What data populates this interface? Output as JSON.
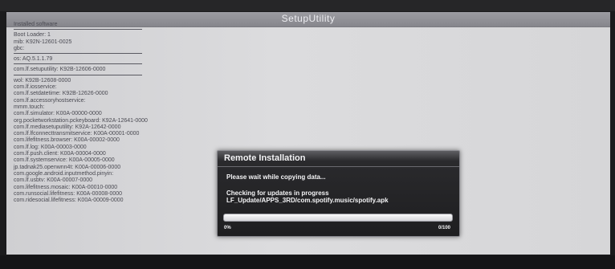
{
  "window": {
    "title": "SetupUtility"
  },
  "info_sections": [
    {
      "lines": [
        "Installed software"
      ]
    },
    {
      "lines": [
        "Boot Loader: 1",
        "mib: K92N-12601-0025",
        "gbc:"
      ]
    },
    {
      "lines": [
        "os: AQ.5.1.1.79"
      ]
    },
    {
      "lines": [
        "com.lf.setuputility: K92B-12606-0000"
      ]
    },
    {
      "lines": [
        "wol: K92B-12608-0000",
        "com.lf.iosservice:",
        "com.lf.setdatetime: K92B-12626-0000",
        "com.lf.accessoryhostservice:",
        "mmm.touch:",
        "com.lf.simulator: K00A-00000-0000",
        "org.pocketworkstation.pckeyboard: K92A-12641-0000",
        "com.lf.mediasetuputility: K92A-12642-0000",
        "com.lf.lfconnecttransmitservice: K00A-00001-0000",
        "com.lifefitness.browser: K00A-00002-0000",
        "com.lf.log: K00A-00003-0000",
        "com.lf.push.client: K00A-00004-0000",
        "com.lf.systemservice: K00A-00005-0000",
        "jp.tadnak25.openwnn4t: K00A-00006-0000",
        "com.google.android.inputmethod.pinyin:",
        "com.lf.usbtv: K00A-00007-0000",
        "com.lifefitness.mosaic: K00A-00010-0000",
        "com.runsocial.lifefitness: K00A-00008-0000",
        "com.ridesocial.lifefitness: K00A-00009-0000"
      ]
    }
  ],
  "dialog": {
    "title": "Remote Installation",
    "wait_message": "Please wait while copying data...",
    "status_line": "Checking for updates in progress",
    "path_line": "LF_Update/APPS_3RD/com.spotify.music/spotify.apk",
    "progress_fraction": 0,
    "progress_percent_label": "0%",
    "progress_count_label": "0/100"
  },
  "colors": {
    "accent": "#4a8ad6",
    "dialog_bg": "#1e1e20",
    "screen_bg": "#d8d8da"
  }
}
